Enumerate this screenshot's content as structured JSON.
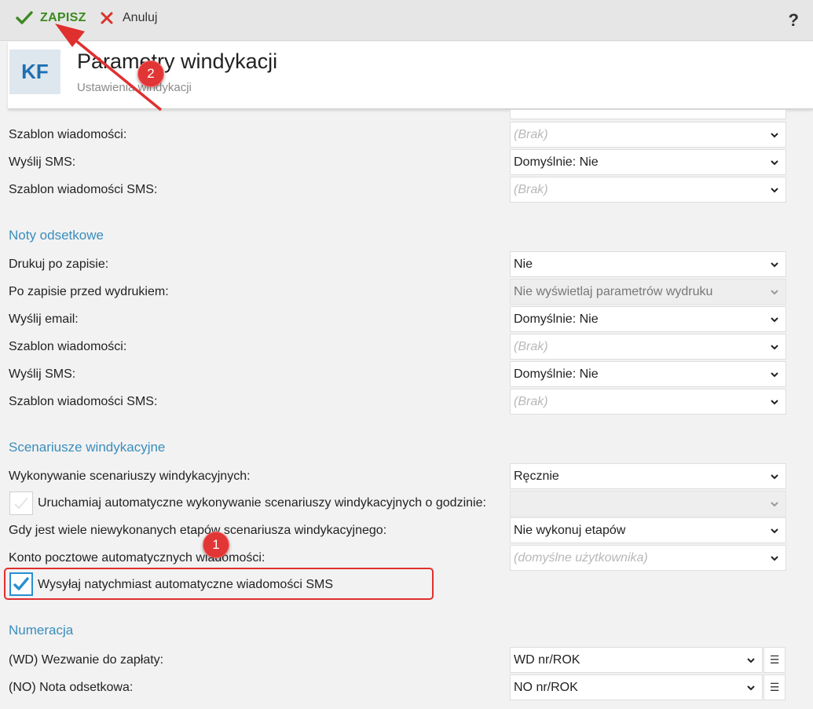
{
  "toolbar": {
    "save_label": "ZAPISZ",
    "cancel_label": "Anuluj",
    "help_label": "?"
  },
  "header": {
    "logo_text": "KF",
    "title": "Parametry windykacji",
    "subtitle": "Ustawienia windykacji"
  },
  "colors": {
    "accent": "#3a8dbd",
    "save_green": "#3b8a1f",
    "cancel_red": "#d9322b",
    "annotation_red": "#e02f2f",
    "checkbox_blue": "#2a8fd0"
  },
  "rows_top": [
    {
      "label": "Szablon wiadomości:",
      "value": "(Brak)",
      "placeholder": true
    },
    {
      "label": "Wyślij SMS:",
      "value": "Domyślnie: Nie",
      "placeholder": false
    },
    {
      "label": "Szablon wiadomości SMS:",
      "value": "(Brak)",
      "placeholder": true
    }
  ],
  "noty": {
    "title": "Noty odsetkowe",
    "rows": [
      {
        "label": "Drukuj po zapisie:",
        "value": "Nie"
      },
      {
        "label": "Po zapisie przed wydrukiem:",
        "value": "Nie wyświetlaj parametrów wydruku"
      },
      {
        "label": "Wyślij email:",
        "value": "Domyślnie: Nie"
      },
      {
        "label": "Szablon wiadomości:",
        "value": "(Brak)"
      },
      {
        "label": "Wyślij SMS:",
        "value": "Domyślnie: Nie"
      },
      {
        "label": "Szablon wiadomości SMS:",
        "value": "(Brak)"
      }
    ]
  },
  "scenariusze": {
    "title": "Scenariusze windykacyjne",
    "wykonywanie_label": "Wykonywanie scenariuszy windykacyjnych:",
    "wykonywanie_value": "Ręcznie",
    "auto_label": "Uruchamiaj automatyczne wykonywanie scenariuszy windykacyjnych o godzinie:",
    "auto_checked": false,
    "etapy_label": "Gdy jest wiele niewykonanych etapów scenariusza windykacyjnego:",
    "etapy_value": "Nie wykonuj etapów",
    "konto_label": "Konto pocztowe automatycznych wiadomości:",
    "konto_value": "(domyślne użytkownika)",
    "sms_label": "Wysyłaj natychmiast automatyczne wiadomości SMS",
    "sms_checked": true
  },
  "numeracja": {
    "title": "Numeracja",
    "rows": [
      {
        "label": "(WD) Wezwanie do zapłaty:",
        "value": "WD nr/ROK"
      },
      {
        "label": "(NO) Nota odsetkowa:",
        "value": "NO nr/ROK"
      }
    ]
  },
  "annotations": {
    "badge_1": "1",
    "badge_2": "2"
  }
}
